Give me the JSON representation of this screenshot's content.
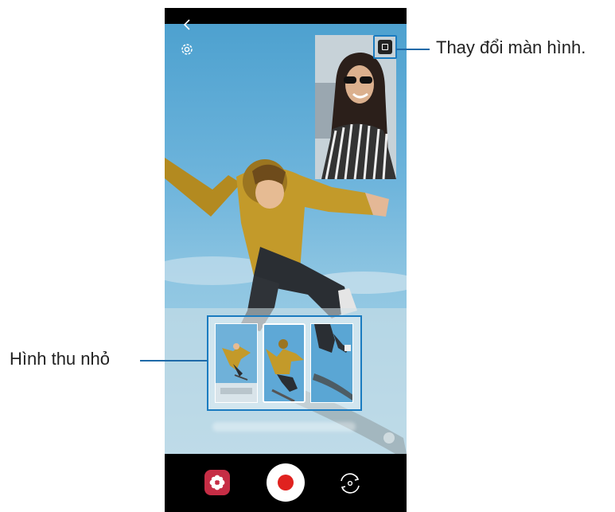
{
  "callouts": {
    "swap_screen": "Thay đổi màn hình.",
    "thumbnails": "Hình thu nhỏ"
  },
  "icons": {
    "back": "back-arrow-icon",
    "settings": "gear-icon",
    "swap": "swap-screen-icon",
    "filter": "filter-flower-icon",
    "record": "record-icon",
    "flip": "flip-camera-icon"
  },
  "colors": {
    "callout_accent": "#1a7bc0",
    "record_red": "#e0221f",
    "filter_red": "#c62d45",
    "sky": "#4a9fce"
  },
  "thumbnails": {
    "count": 3,
    "selected_index": 1
  }
}
